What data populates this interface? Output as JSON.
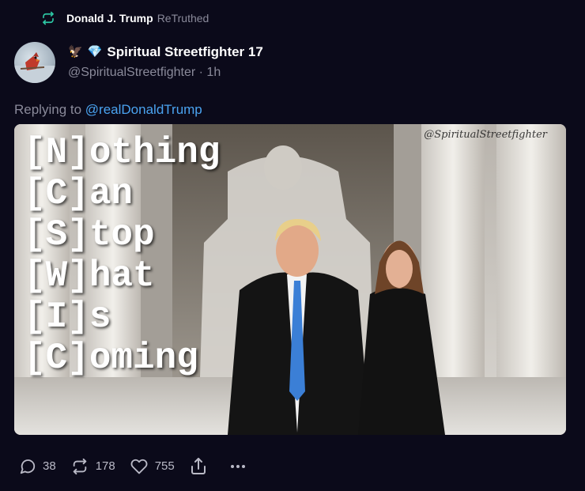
{
  "retruth": {
    "name": "Donald J. Trump",
    "label": "ReTruthed"
  },
  "author": {
    "display_name": "Spiritual Streetfighter 17",
    "handle": "@SpiritualStreetfighter · 1h"
  },
  "reply": {
    "prefix": "Replying to",
    "link": "@realDonaldTrump"
  },
  "media": {
    "watermark": "@SpiritualStreetfighter",
    "lines": [
      "[N]othing",
      "[C]an",
      "[S]top",
      "[W]hat",
      "[I]s",
      "[C]oming"
    ]
  },
  "actions": {
    "replies": "38",
    "retruths": "178",
    "likes": "755"
  },
  "colors": {
    "background": "#0b0a1a",
    "accent": "#4aa3f0",
    "retruth_green": "#2dc7a4"
  }
}
